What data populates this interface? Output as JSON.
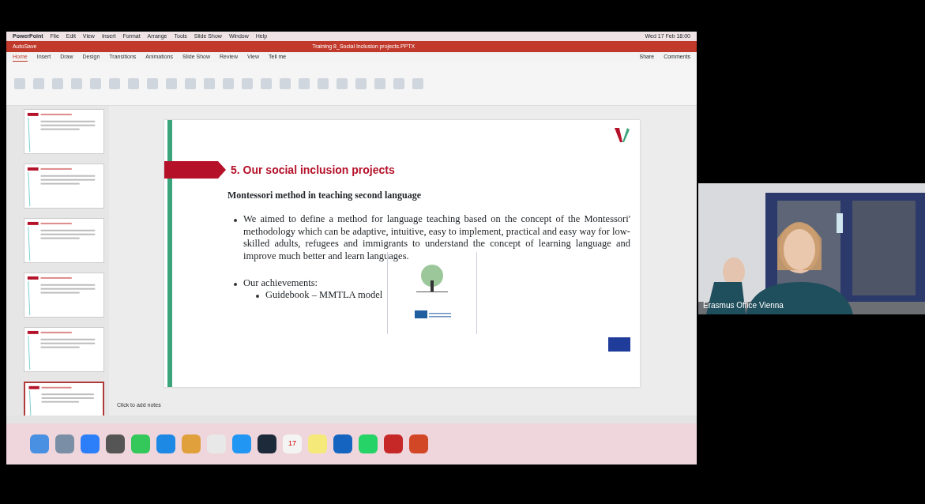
{
  "menu_bar": {
    "app": "PowerPoint",
    "items": [
      "File",
      "Edit",
      "View",
      "Insert",
      "Format",
      "Arrange",
      "Tools",
      "Slide Show",
      "Window",
      "Help"
    ],
    "clock": "Wed 17 Feb 18:00"
  },
  "title_bar": {
    "autosave": "AutoSave",
    "title": "Training 8_Social Inclusion projects.PPTX"
  },
  "ribbon": {
    "tabs": [
      {
        "label": "Home",
        "selected": true
      },
      {
        "label": "Insert",
        "selected": false
      },
      {
        "label": "Draw",
        "selected": false
      },
      {
        "label": "Design",
        "selected": false
      },
      {
        "label": "Transitions",
        "selected": false
      },
      {
        "label": "Animations",
        "selected": false
      },
      {
        "label": "Slide Show",
        "selected": false
      },
      {
        "label": "Review",
        "selected": false
      },
      {
        "label": "View",
        "selected": false
      }
    ],
    "tell_me": "Tell me",
    "share": "Share",
    "comments": "Comments"
  },
  "thumbnails": [
    {
      "selected": false
    },
    {
      "selected": false
    },
    {
      "selected": false
    },
    {
      "selected": false
    },
    {
      "selected": false
    },
    {
      "selected": true
    }
  ],
  "slide": {
    "heading": "5. Our social inclusion projects",
    "subheading": "Montessori method in teaching second language",
    "bullets": [
      {
        "text": "We aimed to define a method for language teaching based on the concept of the Montessori' methodology which can be adaptive, intuitive, easy to implement, practical and easy way for low-skilled adults, refugees and immigrants to understand the concept of learning language and improve much better and learn languages."
      },
      {
        "text": "Our achievements:",
        "children": [
          {
            "text": "Guidebook – MMTLA model"
          }
        ]
      }
    ]
  },
  "notes_placeholder": "Click to add notes",
  "dock": {
    "calendar_day": "17",
    "apps": [
      {
        "color": "#4a90e2"
      },
      {
        "color": "#7a8fa6"
      },
      {
        "color": "#2d7ff9"
      },
      {
        "color": "#555555"
      },
      {
        "color": "#34c759"
      },
      {
        "color": "#1e88e5"
      },
      {
        "color": "#e0a03c"
      },
      {
        "color": "#e8e8e8"
      },
      {
        "color": "#2196f3"
      },
      {
        "color": "#1c2a3a"
      },
      {
        "color": "#f4f4f4"
      },
      {
        "color": "#f5e97a"
      },
      {
        "color": "#1565c0"
      },
      {
        "color": "#25d366"
      },
      {
        "color": "#c62828"
      },
      {
        "color": "#d24726"
      }
    ]
  },
  "participant": {
    "name": "Erasmus Office Vienna"
  }
}
